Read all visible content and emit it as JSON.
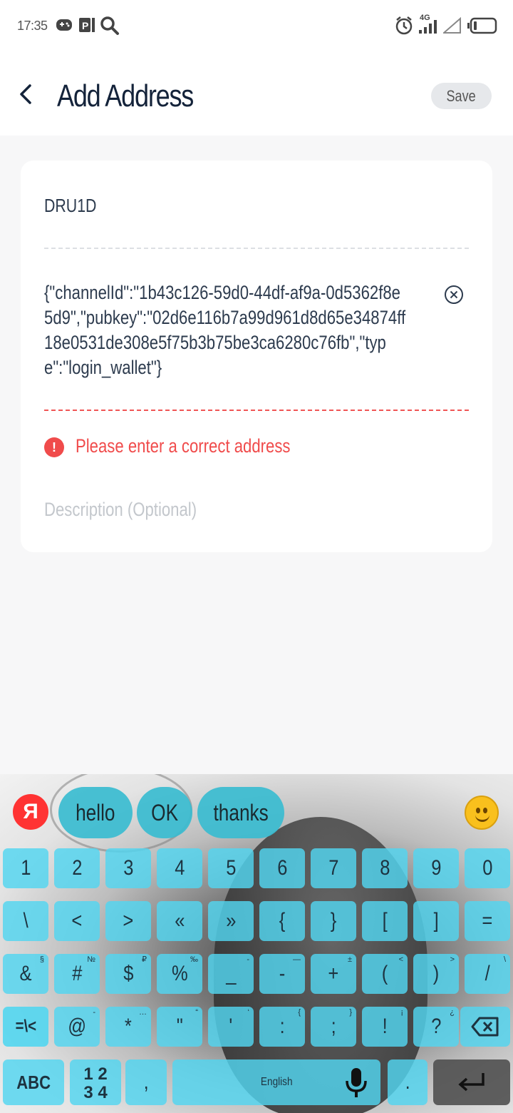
{
  "status_bar": {
    "time": "17:35",
    "network": "4G",
    "icons": [
      "gamepad-icon",
      "parking-icon",
      "search-icon",
      "alarm-icon",
      "signal-icon",
      "wifi-off-icon",
      "battery-icon"
    ]
  },
  "header": {
    "title": "Add Address",
    "save_label": "Save"
  },
  "form": {
    "name_value": "DRU1D",
    "address_value": "{\"channelId\":\"1b43c126-59d0-44df-af9a-0d5362f8e5d9\",\"pubkey\":\"02d6e116b7a99d961d8d65e34874ff18e0531de308e5f75b3b75be3ca6280c76fb\",\"type\":\"login_wallet\"}",
    "error_icon": "!",
    "error_text": "Please enter a correct address",
    "description_placeholder": "Description (Optional)"
  },
  "keyboard": {
    "logo": "Я",
    "suggestions": [
      "hello",
      "OK",
      "thanks"
    ],
    "rows": [
      [
        {
          "k": "1",
          "s": ""
        },
        {
          "k": "2",
          "s": ""
        },
        {
          "k": "3",
          "s": ""
        },
        {
          "k": "4",
          "s": ""
        },
        {
          "k": "5",
          "s": ""
        },
        {
          "k": "6",
          "s": ""
        },
        {
          "k": "7",
          "s": ""
        },
        {
          "k": "8",
          "s": ""
        },
        {
          "k": "9",
          "s": ""
        },
        {
          "k": "0",
          "s": ""
        }
      ],
      [
        {
          "k": "\\",
          "s": ""
        },
        {
          "k": "<",
          "s": ""
        },
        {
          "k": ">",
          "s": ""
        },
        {
          "k": "«",
          "s": ""
        },
        {
          "k": "»",
          "s": ""
        },
        {
          "k": "{",
          "s": ""
        },
        {
          "k": "}",
          "s": ""
        },
        {
          "k": "[",
          "s": ""
        },
        {
          "k": "]",
          "s": ""
        },
        {
          "k": "=",
          "s": ""
        }
      ],
      [
        {
          "k": "&",
          "s": "§"
        },
        {
          "k": "#",
          "s": "№"
        },
        {
          "k": "$",
          "s": "₽"
        },
        {
          "k": "%",
          "s": "‰"
        },
        {
          "k": "_",
          "s": "-"
        },
        {
          "k": "-",
          "s": "—"
        },
        {
          "k": "+",
          "s": "±"
        },
        {
          "k": "(",
          "s": "<"
        },
        {
          "k": ")",
          "s": ">"
        },
        {
          "k": "/",
          "s": "\\"
        }
      ],
      [
        {
          "k": "@",
          "s": "-"
        },
        {
          "k": "*",
          "s": "…"
        },
        {
          "k": "\"",
          "s": "“"
        },
        {
          "k": "'",
          "s": "‘"
        },
        {
          "k": ":",
          "s": "{"
        },
        {
          "k": ";",
          "s": "}"
        },
        {
          "k": "!",
          "s": "¡"
        },
        {
          "k": "?",
          "s": "¿"
        }
      ]
    ],
    "symbols_switch": "=\\<",
    "abc_label": "ABC",
    "numpad_label": "1 2\n3 4",
    "comma": ",",
    "space_label": "English",
    "period": "."
  }
}
